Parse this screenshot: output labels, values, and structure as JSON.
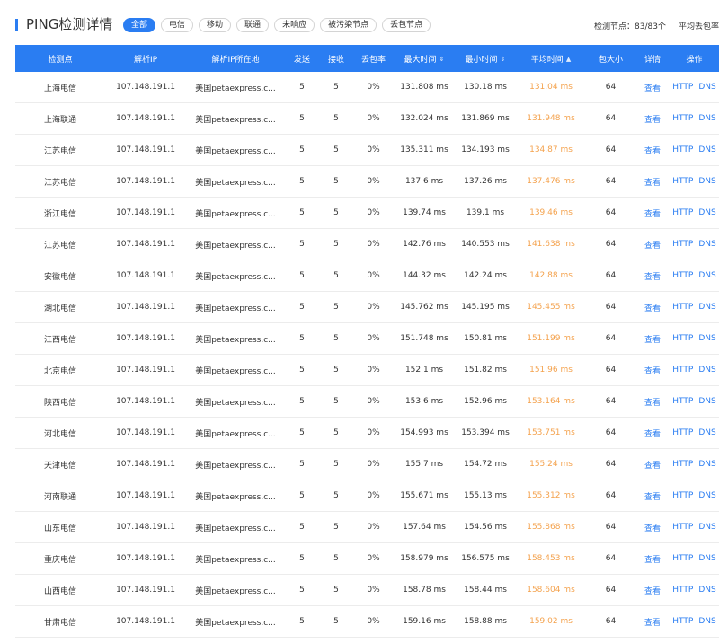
{
  "header": {
    "title": "PING检测详情",
    "filters": [
      "全部",
      "电信",
      "移动",
      "联通",
      "未响应",
      "被污染节点",
      "丢包节点"
    ],
    "active_filter": "全部",
    "summary_nodes": "检测节点：83/83个",
    "summary_loss": "平均丢包率"
  },
  "table": {
    "columns": [
      "检测点",
      "解析IP",
      "解析IP所在地",
      "发送",
      "接收",
      "丢包率",
      "最大时间",
      "最小时间",
      "平均时间",
      "包大小",
      "详情",
      "操作"
    ],
    "sort_icons": {
      "max": "⇕",
      "min": "⇕",
      "avg": "▲"
    },
    "rows": [
      {
        "node": "上海电信",
        "ip": "107.148.191.1",
        "location": "美国petaexpress.c...",
        "sent": "5",
        "recv": "5",
        "loss": "0%",
        "max": "131.808 ms",
        "min": "130.18 ms",
        "avg": "131.04 ms",
        "size": "64",
        "detail": "查看",
        "op_http": "HTTP",
        "op_dns": "DNS"
      },
      {
        "node": "上海联通",
        "ip": "107.148.191.1",
        "location": "美国petaexpress.c...",
        "sent": "5",
        "recv": "5",
        "loss": "0%",
        "max": "132.024 ms",
        "min": "131.869 ms",
        "avg": "131.948 ms",
        "size": "64",
        "detail": "查看",
        "op_http": "HTTP",
        "op_dns": "DNS"
      },
      {
        "node": "江苏电信",
        "ip": "107.148.191.1",
        "location": "美国petaexpress.c...",
        "sent": "5",
        "recv": "5",
        "loss": "0%",
        "max": "135.311 ms",
        "min": "134.193 ms",
        "avg": "134.87 ms",
        "size": "64",
        "detail": "查看",
        "op_http": "HTTP",
        "op_dns": "DNS"
      },
      {
        "node": "江苏电信",
        "ip": "107.148.191.1",
        "location": "美国petaexpress.c...",
        "sent": "5",
        "recv": "5",
        "loss": "0%",
        "max": "137.6 ms",
        "min": "137.26 ms",
        "avg": "137.476 ms",
        "size": "64",
        "detail": "查看",
        "op_http": "HTTP",
        "op_dns": "DNS"
      },
      {
        "node": "浙江电信",
        "ip": "107.148.191.1",
        "location": "美国petaexpress.c...",
        "sent": "5",
        "recv": "5",
        "loss": "0%",
        "max": "139.74 ms",
        "min": "139.1 ms",
        "avg": "139.46 ms",
        "size": "64",
        "detail": "查看",
        "op_http": "HTTP",
        "op_dns": "DNS"
      },
      {
        "node": "江苏电信",
        "ip": "107.148.191.1",
        "location": "美国petaexpress.c...",
        "sent": "5",
        "recv": "5",
        "loss": "0%",
        "max": "142.76 ms",
        "min": "140.553 ms",
        "avg": "141.638 ms",
        "size": "64",
        "detail": "查看",
        "op_http": "HTTP",
        "op_dns": "DNS"
      },
      {
        "node": "安徽电信",
        "ip": "107.148.191.1",
        "location": "美国petaexpress.c...",
        "sent": "5",
        "recv": "5",
        "loss": "0%",
        "max": "144.32 ms",
        "min": "142.24 ms",
        "avg": "142.88 ms",
        "size": "64",
        "detail": "查看",
        "op_http": "HTTP",
        "op_dns": "DNS"
      },
      {
        "node": "湖北电信",
        "ip": "107.148.191.1",
        "location": "美国petaexpress.c...",
        "sent": "5",
        "recv": "5",
        "loss": "0%",
        "max": "145.762 ms",
        "min": "145.195 ms",
        "avg": "145.455 ms",
        "size": "64",
        "detail": "查看",
        "op_http": "HTTP",
        "op_dns": "DNS"
      },
      {
        "node": "江西电信",
        "ip": "107.148.191.1",
        "location": "美国petaexpress.c...",
        "sent": "5",
        "recv": "5",
        "loss": "0%",
        "max": "151.748 ms",
        "min": "150.81 ms",
        "avg": "151.199 ms",
        "size": "64",
        "detail": "查看",
        "op_http": "HTTP",
        "op_dns": "DNS"
      },
      {
        "node": "北京电信",
        "ip": "107.148.191.1",
        "location": "美国petaexpress.c...",
        "sent": "5",
        "recv": "5",
        "loss": "0%",
        "max": "152.1 ms",
        "min": "151.82 ms",
        "avg": "151.96 ms",
        "size": "64",
        "detail": "查看",
        "op_http": "HTTP",
        "op_dns": "DNS"
      },
      {
        "node": "陕西电信",
        "ip": "107.148.191.1",
        "location": "美国petaexpress.c...",
        "sent": "5",
        "recv": "5",
        "loss": "0%",
        "max": "153.6 ms",
        "min": "152.96 ms",
        "avg": "153.164 ms",
        "size": "64",
        "detail": "查看",
        "op_http": "HTTP",
        "op_dns": "DNS"
      },
      {
        "node": "河北电信",
        "ip": "107.148.191.1",
        "location": "美国petaexpress.c...",
        "sent": "5",
        "recv": "5",
        "loss": "0%",
        "max": "154.993 ms",
        "min": "153.394 ms",
        "avg": "153.751 ms",
        "size": "64",
        "detail": "查看",
        "op_http": "HTTP",
        "op_dns": "DNS"
      },
      {
        "node": "天津电信",
        "ip": "107.148.191.1",
        "location": "美国petaexpress.c...",
        "sent": "5",
        "recv": "5",
        "loss": "0%",
        "max": "155.7 ms",
        "min": "154.72 ms",
        "avg": "155.24 ms",
        "size": "64",
        "detail": "查看",
        "op_http": "HTTP",
        "op_dns": "DNS"
      },
      {
        "node": "河南联通",
        "ip": "107.148.191.1",
        "location": "美国petaexpress.c...",
        "sent": "5",
        "recv": "5",
        "loss": "0%",
        "max": "155.671 ms",
        "min": "155.13 ms",
        "avg": "155.312 ms",
        "size": "64",
        "detail": "查看",
        "op_http": "HTTP",
        "op_dns": "DNS"
      },
      {
        "node": "山东电信",
        "ip": "107.148.191.1",
        "location": "美国petaexpress.c...",
        "sent": "5",
        "recv": "5",
        "loss": "0%",
        "max": "157.64 ms",
        "min": "154.56 ms",
        "avg": "155.868 ms",
        "size": "64",
        "detail": "查看",
        "op_http": "HTTP",
        "op_dns": "DNS"
      },
      {
        "node": "重庆电信",
        "ip": "107.148.191.1",
        "location": "美国petaexpress.c...",
        "sent": "5",
        "recv": "5",
        "loss": "0%",
        "max": "158.979 ms",
        "min": "156.575 ms",
        "avg": "158.453 ms",
        "size": "64",
        "detail": "查看",
        "op_http": "HTTP",
        "op_dns": "DNS"
      },
      {
        "node": "山西电信",
        "ip": "107.148.191.1",
        "location": "美国petaexpress.c...",
        "sent": "5",
        "recv": "5",
        "loss": "0%",
        "max": "158.78 ms",
        "min": "158.44 ms",
        "avg": "158.604 ms",
        "size": "64",
        "detail": "查看",
        "op_http": "HTTP",
        "op_dns": "DNS"
      },
      {
        "node": "甘肃电信",
        "ip": "107.148.191.1",
        "location": "美国petaexpress.c...",
        "sent": "5",
        "recv": "5",
        "loss": "0%",
        "max": "159.16 ms",
        "min": "158.88 ms",
        "avg": "159.02 ms",
        "size": "64",
        "detail": "查看",
        "op_http": "HTTP",
        "op_dns": "DNS"
      }
    ]
  },
  "colors": {
    "accent": "#2a7df2",
    "avg_text": "#f4a24d",
    "row_border": "#ececec"
  }
}
